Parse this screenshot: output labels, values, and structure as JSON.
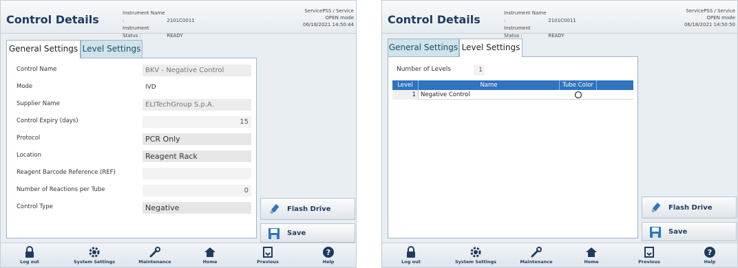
{
  "screen1": {
    "title": "Control Details",
    "instrument": {
      "name_label": "Instrument Name :",
      "name_value": "2101C0011",
      "status_label": "Instrument Status :",
      "status_value": "READY"
    },
    "user": {
      "line1": "ServicePSS / Service",
      "line2": "OPEN mode",
      "line3": "06/18/2021 14:50:44"
    },
    "tabs": [
      "General Settings",
      "Level Settings"
    ],
    "active_tab": "General Settings",
    "fields": [
      {
        "label": "Control Name",
        "value": "BKV - Negative Control"
      },
      {
        "label": "Mode",
        "value": "IVD"
      },
      {
        "label": "Supplier Name",
        "value": "ELITechGroup S.p.A."
      },
      {
        "label": "Control Expiry (days)",
        "value": "15"
      },
      {
        "label": "Protocol",
        "value": "PCR Only"
      },
      {
        "label": "Location",
        "value": "Reagent Rack"
      },
      {
        "label": "Reagent Barcode Reference (REF)",
        "value": ""
      },
      {
        "label": "Number of Reactions per Tube",
        "value": "0"
      },
      {
        "label": "Control Type",
        "value": "Negative"
      }
    ],
    "buttons": {
      "flash_drive": "Flash Drive",
      "save": "Save"
    }
  },
  "screen2": {
    "title": "Control Details",
    "instrument": {
      "name_label": "Instrument Name :",
      "name_value": "2101C0011",
      "status_label": "Instrument Status :",
      "status_value": "READY"
    },
    "user": {
      "line1": "ServicePSS / Service",
      "line2": "OPEN mode",
      "line3": "06/18/2021 14:50:50"
    },
    "tabs": [
      "General Settings",
      "Level Settings"
    ],
    "active_tab": "Level Settings",
    "number_of_levels_label": "Number of Levels",
    "number_of_levels_value": "1",
    "grid": {
      "columns": [
        "Level",
        "Name",
        "Tube Color"
      ],
      "rows": [
        {
          "level": "1",
          "name": "Negative Control",
          "tube_color": "#ffffff"
        }
      ]
    },
    "buttons": {
      "flash_drive": "Flash Drive",
      "save": "Save"
    }
  },
  "bottom_nav": [
    "Log out",
    "System Settings",
    "Maintenance",
    "Home",
    "Previous",
    "Help"
  ],
  "colors": {
    "title": "#1f3a5f",
    "grid_header": "#2e74c0",
    "tab_inactive": "#cfe3ea"
  }
}
